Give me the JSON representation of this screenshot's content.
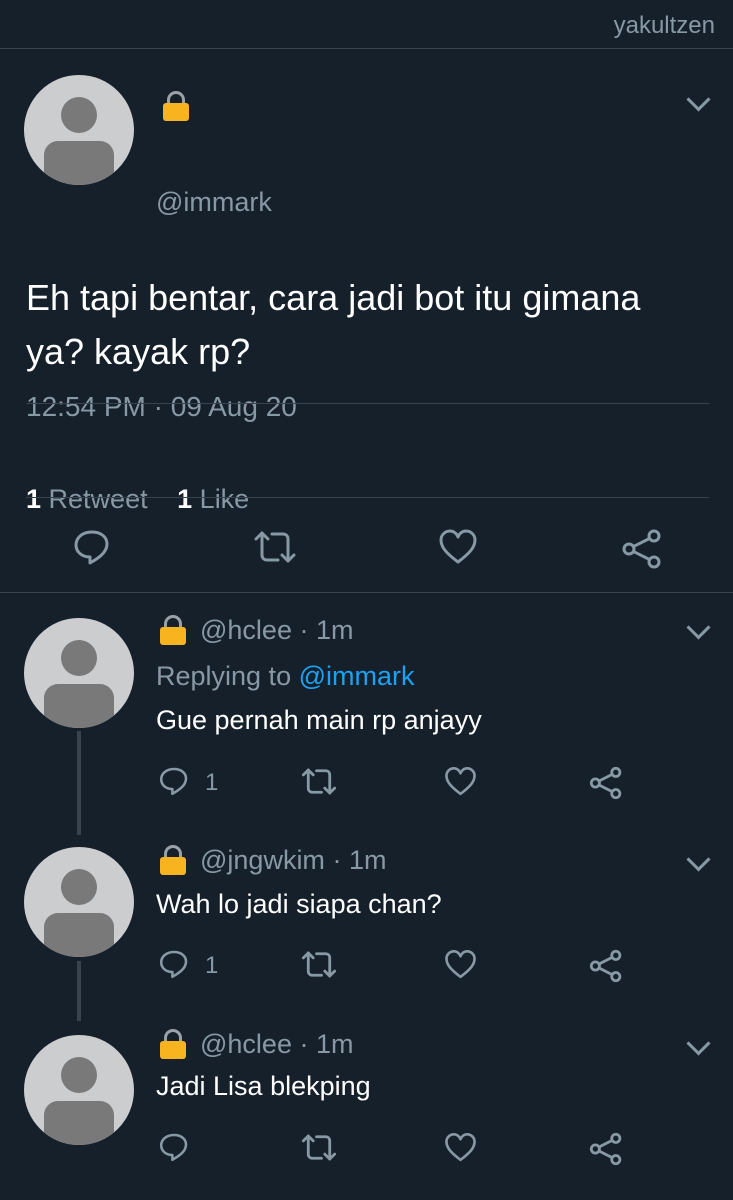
{
  "watermark": "yakultzen",
  "main_tweet": {
    "handle": "@immark",
    "text": "Eh tapi bentar, cara jadi bot itu gimana ya? kayak rp?",
    "timestamp": "12:54 PM · 09 Aug 20",
    "retweet_count": "1",
    "retweet_label": "Retweet",
    "like_count": "1",
    "like_label": "Like"
  },
  "replies": [
    {
      "handle": "@hclee",
      "time": "· 1m",
      "replying_prefix": "Replying to",
      "replying_to": "@immark",
      "text": "Gue pernah main rp anjayy",
      "reply_count": "1"
    },
    {
      "handle": "@jngwkim",
      "time": "· 1m",
      "text": "Wah lo jadi siapa chan?",
      "reply_count": "1"
    },
    {
      "handle": "@hclee",
      "time": "· 1m",
      "text": "Jadi Lisa blekping"
    }
  ],
  "icons": [
    "lock-icon",
    "chevron-down-icon",
    "reply-icon",
    "retweet-icon",
    "like-icon",
    "share-icon"
  ],
  "colors": {
    "background": "#15202b",
    "secondary_text": "#8899a6",
    "link": "#1da1f2",
    "divider": "#38444d",
    "lock": "#f8b41f"
  }
}
